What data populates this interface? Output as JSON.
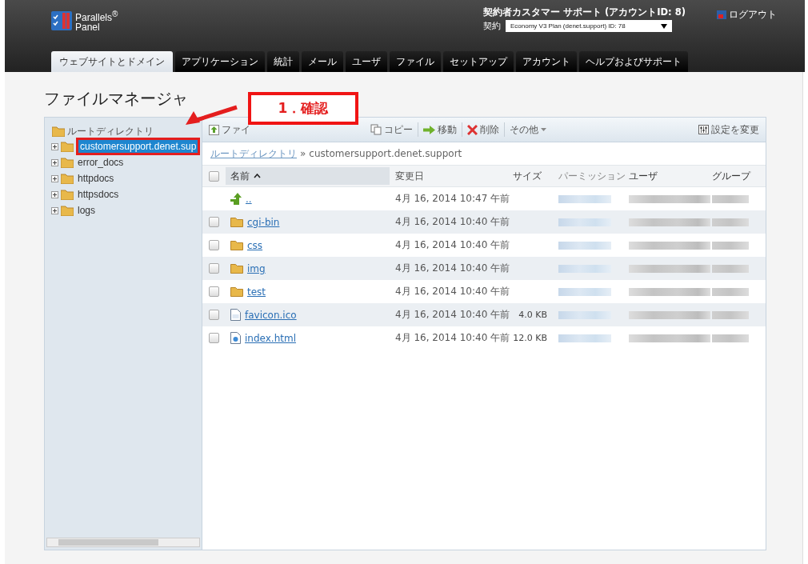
{
  "header": {
    "logo": "Parallels$^{®}$",
    "logo_sub": "Panel",
    "account": "契約者カスタマー サポート (アカウントID: 8)",
    "subscription_label": "契約",
    "subscription": "Economy V3 Plan (denet.support) ID: 78",
    "logout": "ログアウト"
  },
  "tabs": [
    {
      "label": "ウェブサイトとドメイン",
      "selected": true
    },
    {
      "label": "アプリケーション",
      "selected": false
    },
    {
      "label": "統計",
      "selected": false
    },
    {
      "label": "メール",
      "selected": false
    },
    {
      "label": "ユーザ",
      "selected": false
    },
    {
      "label": "ファイル",
      "selected": false
    },
    {
      "label": "セットアップ",
      "selected": false
    },
    {
      "label": "アカウント",
      "selected": false
    },
    {
      "label": "ヘルプおよびサポート",
      "selected": false
    }
  ],
  "page_title": "ファイルマネージャ",
  "tree": {
    "root": "ルートディレクトリ",
    "items": [
      {
        "label": "customersupport.denet.sup",
        "selected": true,
        "expanded": false
      },
      {
        "label": "error_docs",
        "selected": false,
        "expanded": false
      },
      {
        "label": "httpdocs",
        "selected": false,
        "expanded": false
      },
      {
        "label": "httpsdocs",
        "selected": false,
        "expanded": false
      },
      {
        "label": "logs",
        "selected": false,
        "expanded": false
      }
    ]
  },
  "toolbar": {
    "items": [
      {
        "label": "ファイ",
        "kind": "upload"
      },
      {
        "label": "コピー",
        "kind": "copy"
      },
      {
        "label": "移動",
        "kind": "move"
      },
      {
        "label": "削除",
        "kind": "delete"
      },
      {
        "label": "その他",
        "kind": "more"
      }
    ],
    "settings": "設定を変更"
  },
  "breadcrumb": {
    "link": "ルートディレクトリ",
    "separator": "»",
    "current": "customersupport.denet.support"
  },
  "table": {
    "header_checked": false,
    "columns": [
      "名前",
      "変更日",
      "サイズ",
      "パーミッション",
      "ユーザ",
      "グループ"
    ],
    "rows": [
      {
        "name": "..",
        "kind": "up",
        "modified": "4月 16, 2014 10:47 午前",
        "checked": null
      },
      {
        "name": "cgi-bin",
        "kind": "folder",
        "modified": "4月 16, 2014 10:40 午前",
        "checked": false
      },
      {
        "name": "css",
        "kind": "folder",
        "modified": "4月 16, 2014 10:40 午前",
        "checked": false
      },
      {
        "name": "img",
        "kind": "folder",
        "modified": "4月 16, 2014 10:40 午前",
        "checked": false
      },
      {
        "name": "test",
        "kind": "folder",
        "modified": "4月 16, 2014 10:40 午前",
        "checked": false
      },
      {
        "name": "favicon.ico",
        "kind": "binary",
        "modified": "4月 16, 2014 10:40 午前",
        "size": "4.0 KB",
        "checked": false
      },
      {
        "name": "index.html",
        "kind": "web",
        "modified": "4月 16, 2014 10:40 午前",
        "size": "12.0 KB",
        "checked": false
      }
    ]
  },
  "callout": "1．確認"
}
